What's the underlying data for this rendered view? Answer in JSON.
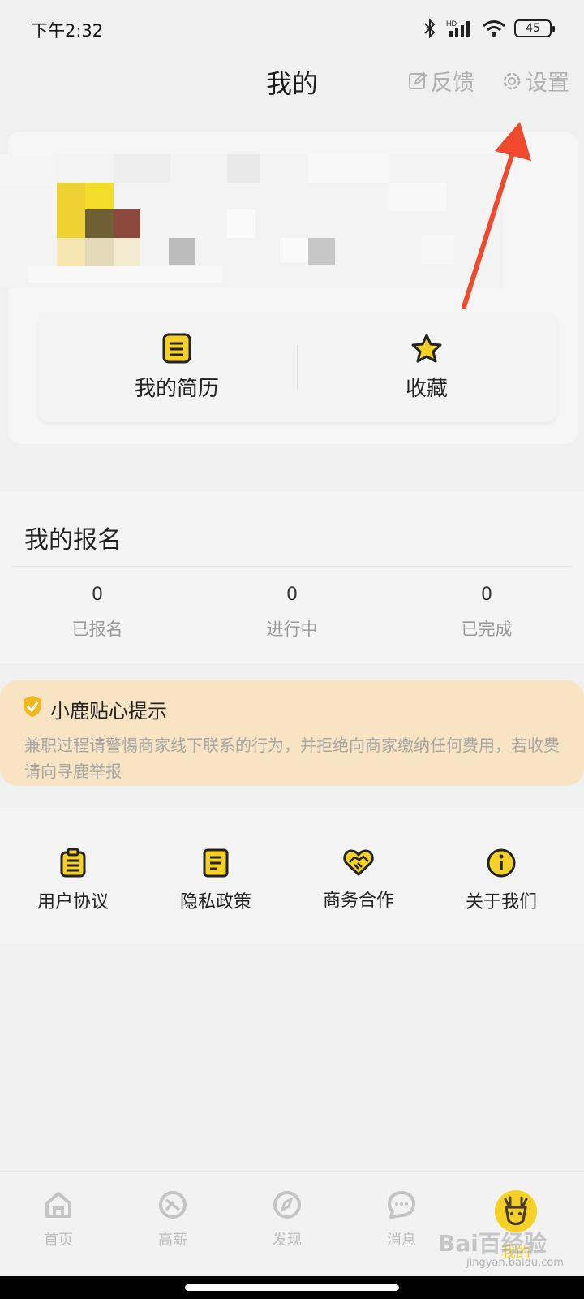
{
  "status": {
    "time": "下午2:32",
    "battery": "45",
    "network": "HD"
  },
  "header": {
    "title": "我的",
    "feedback": "反馈",
    "settings": "设置"
  },
  "quick": {
    "resume": "我的简历",
    "favorites": "收藏"
  },
  "signup": {
    "title": "我的报名",
    "stats": [
      {
        "value": "0",
        "label": "已报名"
      },
      {
        "value": "0",
        "label": "进行中"
      },
      {
        "value": "0",
        "label": "已完成"
      }
    ]
  },
  "tip": {
    "title": "小鹿贴心提示",
    "body": "兼职过程请警惕商家线下联系的行为，并拒绝向商家缴纳任何费用，若收费请向寻鹿举报"
  },
  "links": [
    {
      "label": "用户协议",
      "icon": "clipboard-icon"
    },
    {
      "label": "隐私政策",
      "icon": "document-icon"
    },
    {
      "label": "商务合作",
      "icon": "handshake-icon"
    },
    {
      "label": "关于我们",
      "icon": "info-icon"
    }
  ],
  "tabs": [
    {
      "label": "首页",
      "icon": "home-icon"
    },
    {
      "label": "高薪",
      "icon": "high-salary-icon"
    },
    {
      "label": "发现",
      "icon": "compass-icon"
    },
    {
      "label": "消息",
      "icon": "chat-icon"
    },
    {
      "label": "我的",
      "icon": "deer-icon"
    }
  ],
  "watermark": {
    "main": "Bai百经验",
    "sub": "jingyan.baidu.com"
  },
  "colors": {
    "accent": "#f5d125",
    "tip_bg": "#f8e4c2",
    "arrow": "#f04a2e"
  }
}
